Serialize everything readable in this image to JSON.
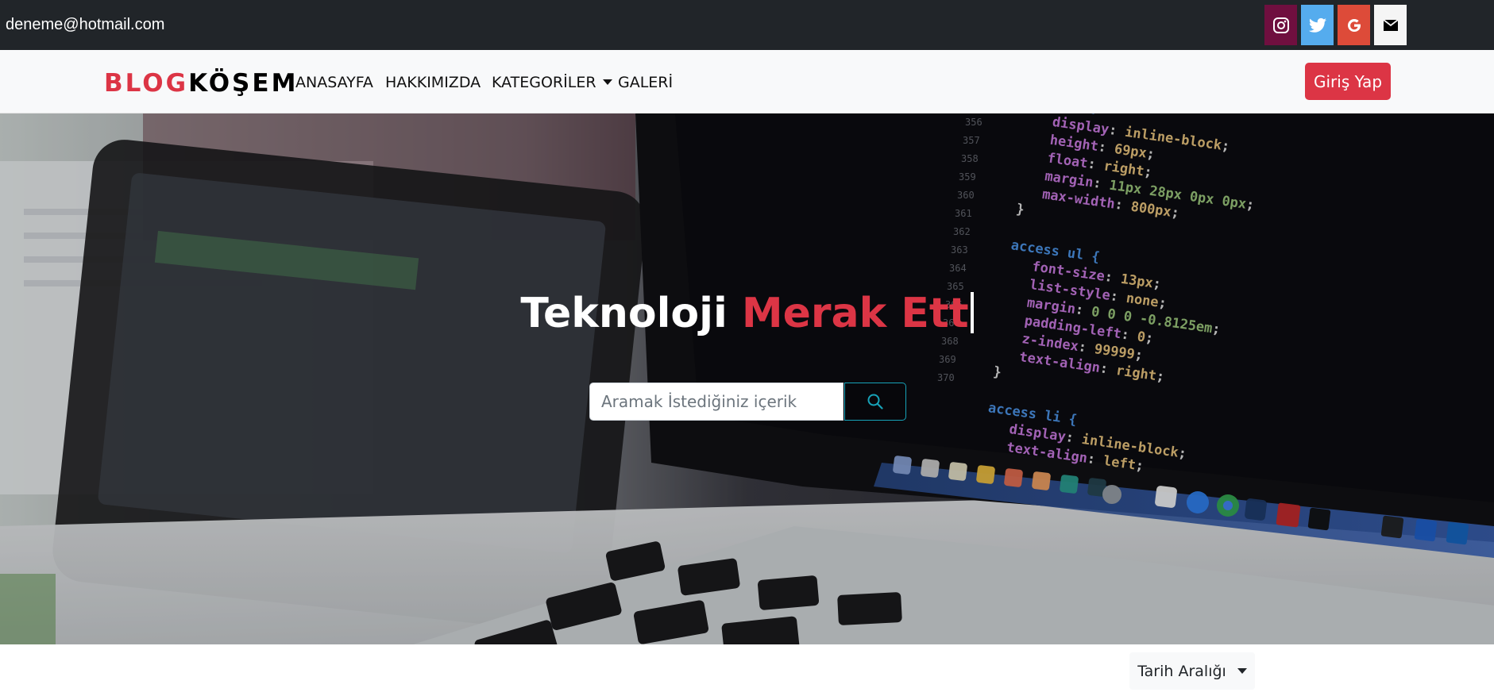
{
  "topbar": {
    "email": "deneme@hotmail.com",
    "social_icons": [
      "instagram-icon",
      "twitter-icon",
      "google-icon",
      "mail-icon"
    ]
  },
  "navbar": {
    "brand_part1": "BLOG",
    "brand_part2": "KÖŞEM",
    "links": [
      "ANASAYFA",
      "HAKKIMIZDA",
      "KATEGORİLER",
      "GALERİ"
    ],
    "login_label": "Giriş Yap"
  },
  "hero": {
    "title_white": "Teknoloji",
    "title_red": "Merak Ett",
    "search_placeholder": "Aramak İstediğiniz içerik"
  },
  "filter": {
    "date_range_label": "Tarih Aralığı"
  },
  "colors": {
    "accent": "#dc3545",
    "topbar": "#212529",
    "navbar": "#f8f9fa"
  }
}
